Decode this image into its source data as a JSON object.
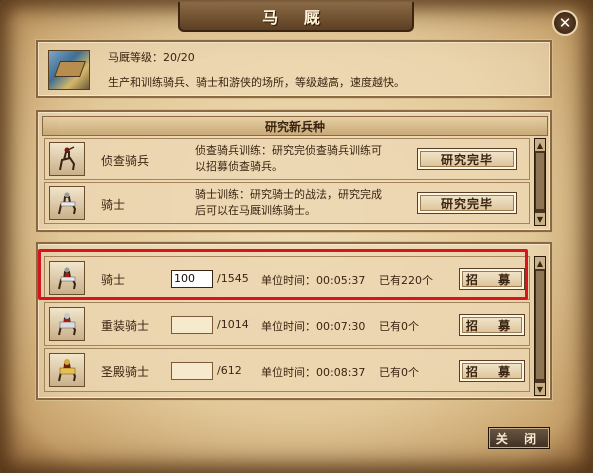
{
  "window": {
    "title": "马 厩",
    "close_glyph": "✕"
  },
  "info": {
    "level_text": "马厩等级：20/20",
    "description": "生产和训练骑兵、骑士和游侠的场所，等级越高，速度越快。",
    "icon": "stable-building-icon"
  },
  "research": {
    "header": "研究新兵种",
    "rows": [
      {
        "name": "侦查骑兵",
        "desc_line1": "侦查骑兵训练：研究完侦查骑兵训练可",
        "desc_line2": "以招募侦查骑兵。",
        "button": "研究完毕",
        "icon": "scout-cavalry-icon"
      },
      {
        "name": "骑士",
        "desc_line1": "骑士训练：研究骑士的战法，研究完成",
        "desc_line2": "后可以在马厩训练骑士。",
        "button": "研究完毕",
        "icon": "knight-icon"
      }
    ]
  },
  "recruit": {
    "rows": [
      {
        "name": "骑士",
        "input": "100",
        "max": "/1545",
        "time": "单位时间：00:05:37",
        "have": "已有220个",
        "button": "招 募",
        "icon": "knight-icon"
      },
      {
        "name": "重装骑士",
        "input": "",
        "max": "/1014",
        "time": "单位时间：00:07:30",
        "have": "已有0个",
        "button": "招 募",
        "icon": "heavy-knight-icon"
      },
      {
        "name": "圣殿骑士",
        "input": "",
        "max": "/612",
        "time": "单位时间：00:08:37",
        "have": "已有0个",
        "button": "招 募",
        "icon": "templar-knight-icon"
      }
    ]
  },
  "footer": {
    "close_label": "关 闭"
  },
  "colors": {
    "highlight": "#d8141e",
    "panel_border": "#8a6a44",
    "parchment": "#e3c999"
  }
}
